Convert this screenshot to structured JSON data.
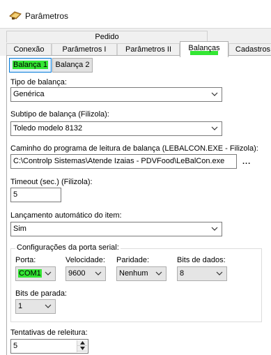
{
  "window": {
    "title": "Parâmetros",
    "icon": "app-icon"
  },
  "tabs": {
    "upper": [
      "Pedido"
    ],
    "lower": [
      "Conexão",
      "Parâmetros I",
      "Parâmetros II",
      "Balanças",
      "Cadastros"
    ],
    "active": "Balanças"
  },
  "subtabs": {
    "balanca1": "Balança 1",
    "balanca2": "Balança 2"
  },
  "fields": {
    "tipo_label": "Tipo de balança:",
    "tipo_value": "Genérica",
    "subtipo_label": "Subtipo de balança (Filizola):",
    "subtipo_value": "Toledo modelo 8132",
    "caminho_label": "Caminho do programa de leitura de balança (LEBALCON.EXE - Filizola):",
    "caminho_value": "C:\\Controlp Sistemas\\Atende Izaias - PDVFood\\LeBalCon.exe",
    "browse_label": "...",
    "timeout_label": "Timeout (sec.) (Filizola):",
    "timeout_value": "5",
    "lancamento_label": "Lançamento automático do item:",
    "lancamento_value": "Sim"
  },
  "serial": {
    "group_caption": "Configurações da porta serial:",
    "porta_label": "Porta:",
    "porta_value": "COM1",
    "velocidade_label": "Velocidade:",
    "velocidade_value": "9600",
    "paridade_label": "Paridade:",
    "paridade_value": "Nenhum",
    "bits_dados_label": "Bits de dados:",
    "bits_dados_value": "8",
    "bits_parada_label": "Bits de parada:",
    "bits_parada_value": "1"
  },
  "releitura": {
    "label": "Tentativas de releitura:",
    "value": "5"
  },
  "colors": {
    "highlight": "#33e633",
    "focus": "#0078d7"
  }
}
